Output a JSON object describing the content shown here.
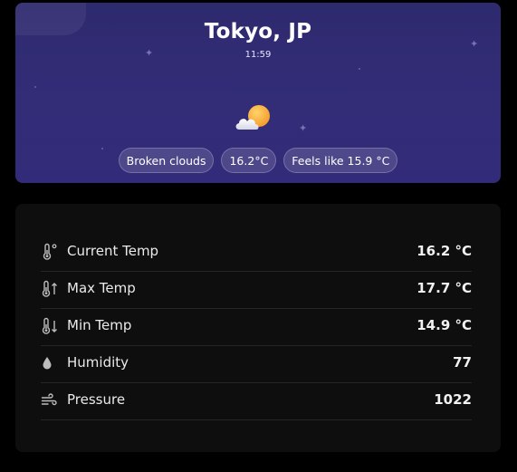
{
  "weather": {
    "city": "Tokyo, JP",
    "time": "11:59",
    "icon": "partly-cloudy-sun-icon",
    "condition": "Broken clouds",
    "temperature": "16.2°C",
    "feels_like": "Feels like 15.9 °C"
  },
  "details": [
    {
      "icon": "thermometer-icon",
      "label": "Current Temp",
      "value": "16.2 °C"
    },
    {
      "icon": "thermometer-up-icon",
      "label": "Max Temp",
      "value": "17.7 °C"
    },
    {
      "icon": "thermometer-down-icon",
      "label": "Min Temp",
      "value": "14.9 °C"
    },
    {
      "icon": "droplet-icon",
      "label": "Humidity",
      "value": "77"
    },
    {
      "icon": "wind-icon",
      "label": "Pressure",
      "value": "1022"
    }
  ],
  "colors": {
    "hero_background": "#332d78",
    "details_background": "#0e0e0e",
    "page_background": "#000000"
  }
}
